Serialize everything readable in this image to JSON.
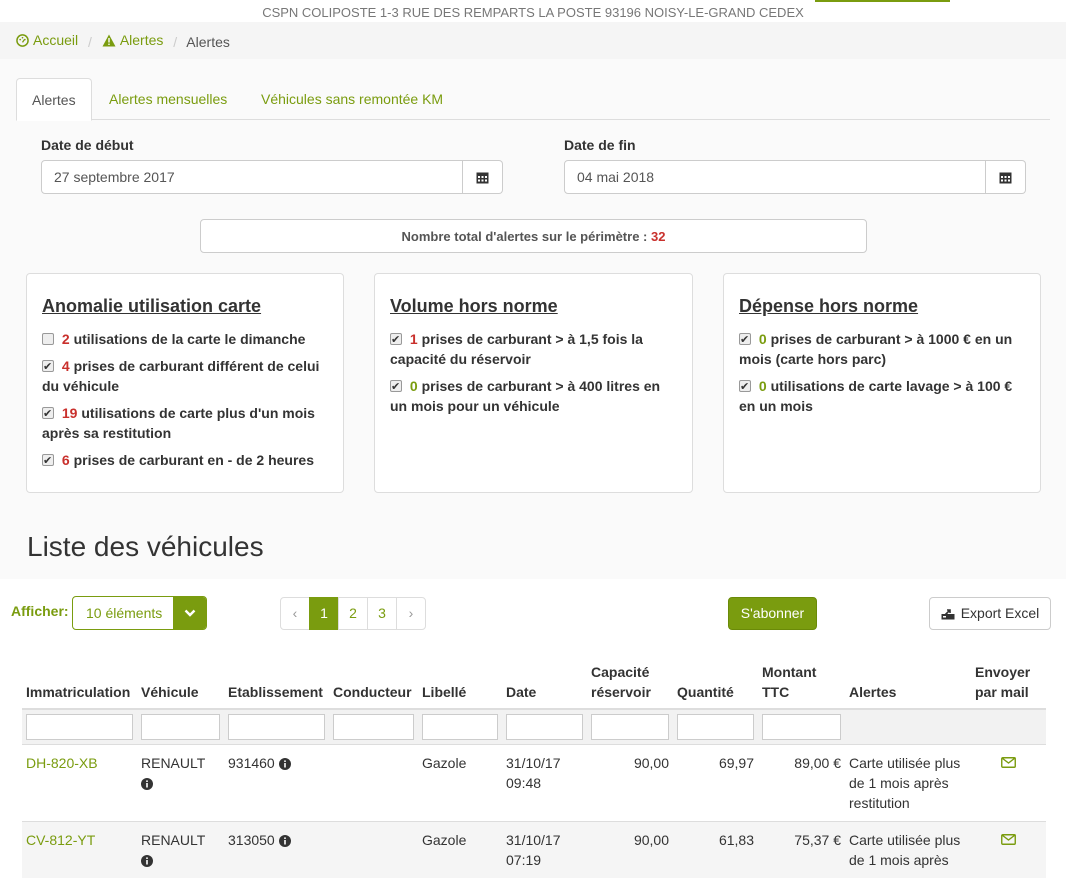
{
  "header": {
    "address": "CSPN COLIPOSTE 1-3 RUE DES REMPARTS LA POSTE 93196 NOISY-LE-GRAND CEDEX"
  },
  "breadcrumb": {
    "home": "Accueil",
    "alerts": "Alertes",
    "current": "Alertes"
  },
  "tabs": [
    {
      "label": "Alertes",
      "active": true
    },
    {
      "label": "Alertes mensuelles",
      "active": false
    },
    {
      "label": "Véhicules sans remontée KM",
      "active": false
    }
  ],
  "filters": {
    "start_label": "Date de début",
    "start_value": "27 septembre 2017",
    "end_label": "Date de fin",
    "end_value": "04 mai 2018"
  },
  "total": {
    "label": "Nombre total d'alertes sur le périmètre :",
    "count": "32"
  },
  "panels": [
    {
      "title": "Anomalie utilisation carte",
      "items": [
        {
          "checked": false,
          "count": "2",
          "text": "utilisations de la carte le dimanche",
          "count_color": "red"
        },
        {
          "checked": true,
          "count": "4",
          "text": "prises de carburant différent de celui du véhicule",
          "count_color": "red"
        },
        {
          "checked": true,
          "count": "19",
          "text": "utilisations de carte plus d'un mois après sa restitution",
          "count_color": "red"
        },
        {
          "checked": true,
          "count": "6",
          "text": "prises de carburant en - de 2 heures",
          "count_color": "red"
        }
      ]
    },
    {
      "title": "Volume hors norme",
      "items": [
        {
          "checked": true,
          "count": "1",
          "text": "prises de carburant > à 1,5 fois la capacité du réservoir",
          "count_color": "red"
        },
        {
          "checked": true,
          "count": "0",
          "text": "prises de carburant > à 400 litres en un mois pour un véhicule",
          "count_color": "green"
        }
      ]
    },
    {
      "title": "Dépense hors norme",
      "items": [
        {
          "checked": true,
          "count": "0",
          "text": "prises de carburant > à 1000 € en un mois (carte hors parc)",
          "count_color": "green"
        },
        {
          "checked": true,
          "count": "0",
          "text": "utilisations de carte lavage > à 100 € en un mois",
          "count_color": "green"
        }
      ]
    }
  ],
  "list": {
    "title": "Liste des véhicules",
    "show_label": "Afficher:",
    "show_value": "10 éléments",
    "pages": [
      "‹",
      "1",
      "2",
      "3",
      "›"
    ],
    "active_page": "1",
    "subscribe_label": "S'abonner",
    "export_label": "Export Excel"
  },
  "table": {
    "headers": [
      "Immatriculation",
      "Véhicule",
      "Etablissement",
      "Conducteur",
      "Libellé",
      "Date",
      "Capacité réservoir",
      "Quantité",
      "Montant TTC",
      "Alertes",
      "Envoyer par mail"
    ],
    "rows": [
      {
        "plate": "DH-820-XB",
        "vehicle": "RENAULT",
        "etab": "931460",
        "driver": "",
        "label": "Gazole",
        "date": "31/10/17 09:48",
        "capacity": "90,00",
        "quantity": "69,97",
        "amount": "89,00 €",
        "alert": "Carte utilisée plus de 1 mois après restitution"
      },
      {
        "plate": "CV-812-YT",
        "vehicle": "RENAULT",
        "etab": "313050",
        "driver": "",
        "label": "Gazole",
        "date": "31/10/17 07:19",
        "capacity": "90,00",
        "quantity": "61,83",
        "amount": "75,37 €",
        "alert": "Carte utilisée plus de 1 mois après"
      }
    ]
  },
  "colors": {
    "accent": "#7a9c0f",
    "alert_red": "#c9302c"
  }
}
